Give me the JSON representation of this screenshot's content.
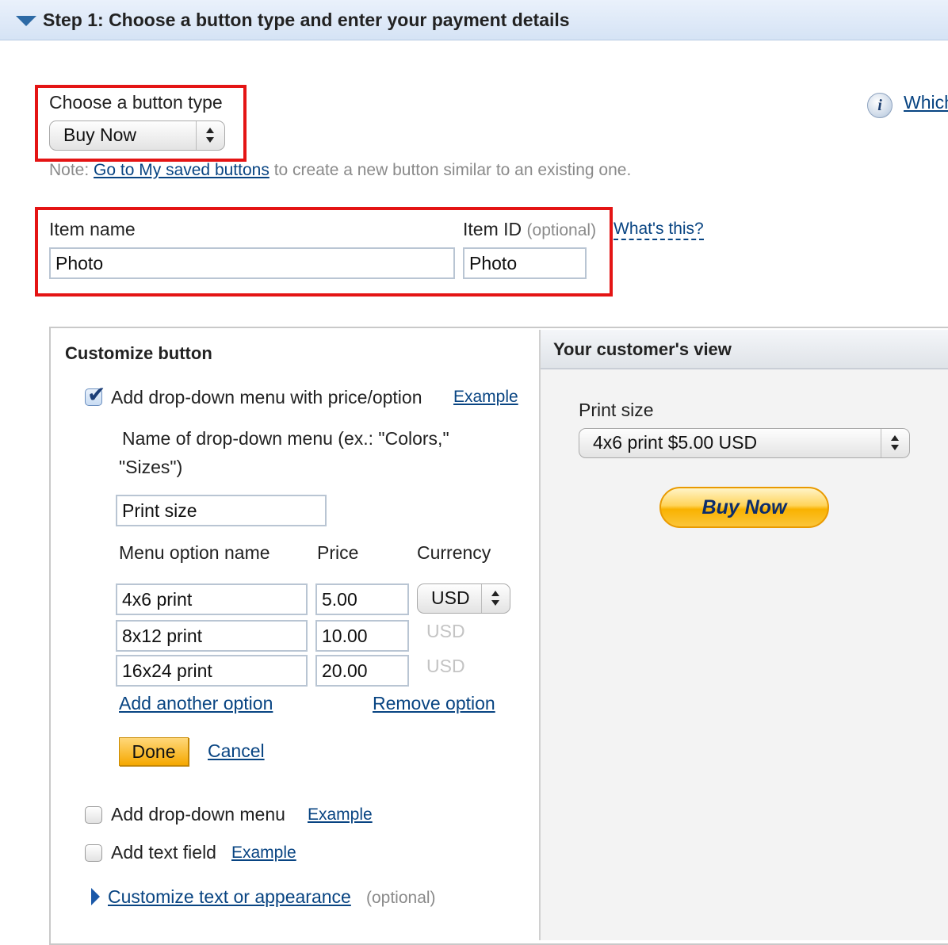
{
  "step": {
    "title": "Step 1: Choose a button type and enter your payment details"
  },
  "button_type": {
    "label": "Choose a button type",
    "selected": "Buy Now",
    "help_link": "Which"
  },
  "note": {
    "prefix": "Note:",
    "link": "Go to My saved buttons",
    "suffix": "to create a new button similar to an existing one."
  },
  "item": {
    "name_label": "Item name",
    "name_value": "Photo",
    "id_label": "Item ID",
    "id_optional": "(optional)",
    "id_value": "Photo",
    "whats_this": "What's this?"
  },
  "customize": {
    "title": "Customize button",
    "dropdown_price": {
      "checked": true,
      "label": "Add drop-down menu with price/option",
      "example": "Example"
    },
    "menu_name_label_line1": "Name of drop-down menu (ex.: \"Colors,\"",
    "menu_name_label_line2": "\"Sizes\")",
    "menu_name_value": "Print size",
    "col_option": "Menu option name",
    "col_price": "Price",
    "col_currency": "Currency",
    "options": [
      {
        "name": "4x6 print",
        "price": "5.00",
        "currency": "USD"
      },
      {
        "name": "8x12 print",
        "price": "10.00",
        "currency": "USD"
      },
      {
        "name": "16x24 print",
        "price": "20.00",
        "currency": "USD"
      }
    ],
    "add_option": "Add another option",
    "remove_option": "Remove option",
    "done": "Done",
    "cancel": "Cancel",
    "dropdown_menu": {
      "checked": false,
      "label": "Add drop-down menu",
      "example": "Example"
    },
    "text_field": {
      "checked": false,
      "label": "Add text field",
      "example": "Example"
    },
    "customize_text": "Customize text or appearance",
    "customize_optional": "(optional)"
  },
  "preview": {
    "title": "Your customer's view",
    "field_label": "Print size",
    "selected_option": "4x6 print $5.00 USD",
    "buy_button": "Buy Now"
  },
  "colors": {
    "highlight_border": "#e41414",
    "link": "#084482",
    "done_button": "#f5a800"
  }
}
